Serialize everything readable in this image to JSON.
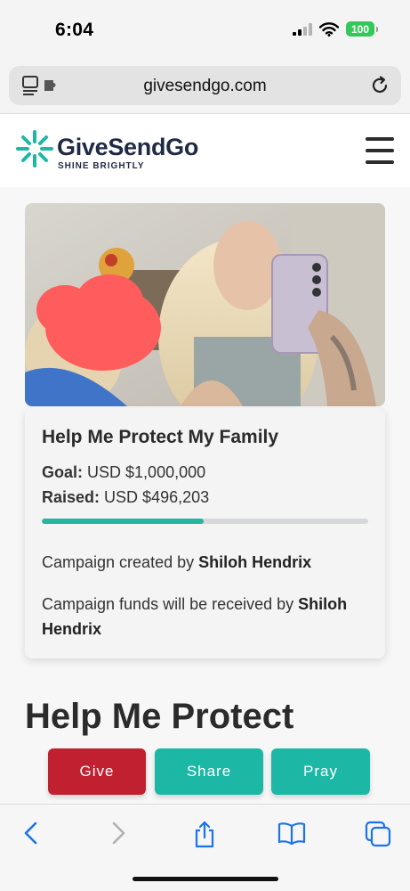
{
  "status_bar": {
    "time": "6:04",
    "battery": "100"
  },
  "browser": {
    "url": "givesendgo.com",
    "icons": {
      "left": "reader-extension-icon",
      "right": "reload-icon"
    }
  },
  "site": {
    "brand_name": "GiveSendGo",
    "tagline": "SHINE BRIGHTLY",
    "brand_color": "#1db8a5",
    "brand_text_color": "#1f2a44"
  },
  "campaign": {
    "title": "Help Me Protect My Family",
    "goal_label": "Goal:",
    "goal_value": "USD $1,000,000",
    "raised_label": "Raised:",
    "raised_value": "USD $496,203",
    "progress_fraction": 0.496,
    "created_by_prefix": "Campaign created by",
    "created_by_name": "Shiloh Hendrix",
    "received_by_prefix": "Campaign funds will be received by",
    "received_by_name": "Shiloh Hendrix",
    "heading": "Help Me Protect"
  },
  "actions": {
    "give_label": "Give",
    "share_label": "Share",
    "pray_label": "Pray",
    "give_color": "#c0202f",
    "share_color": "#1db8a5",
    "pray_color": "#1db8a5"
  },
  "toolbar": {
    "icons": [
      "back-icon",
      "forward-icon",
      "share-icon",
      "bookmarks-icon",
      "tabs-icon"
    ]
  }
}
